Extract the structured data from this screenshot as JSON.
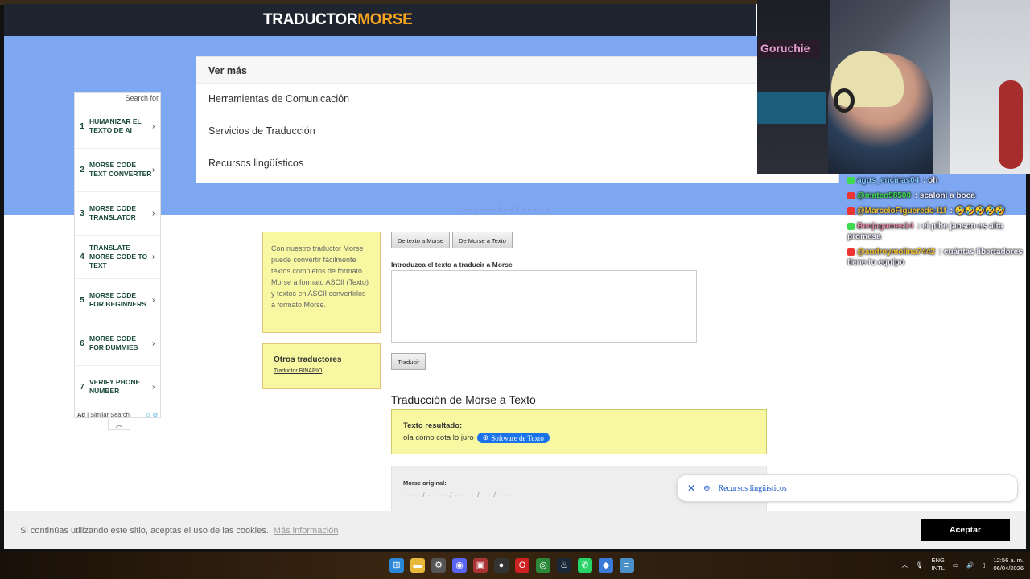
{
  "site": {
    "logo_part1": "TRADUCTOR",
    "logo_part2": "MORSE"
  },
  "ver_mas": {
    "heading": "Ver más",
    "items": [
      "Herramientas de Comunicación",
      "Servicios de Traducción",
      "Recursos lingüísticos"
    ]
  },
  "ad": {
    "search_label": "Search for",
    "items": [
      {
        "num": "1",
        "label": "HUMANIZAR EL TEXTO DE AI"
      },
      {
        "num": "2",
        "label": "MORSE CODE TEXT CONVERTER"
      },
      {
        "num": "3",
        "label": "MORSE CODE TRANSLATOR"
      },
      {
        "num": "4",
        "label": "TRANSLATE MORSE CODE TO TEXT"
      },
      {
        "num": "5",
        "label": "MORSE CODE FOR BEGINNERS"
      },
      {
        "num": "6",
        "label": "MORSE CODE FOR DUMMIES"
      },
      {
        "num": "7",
        "label": "VERIFY PHONE NUMBER"
      }
    ],
    "footer_ad": "Ad",
    "footer_label": "Similar Search"
  },
  "info": {
    "text": "Con nuestro traductor Morse puede convertir fácilmente textos completos de formato Morse a formato ASCII (Texto) y textos en ASCII convertirlos a formato Morse."
  },
  "otros": {
    "title": "Otros traductores",
    "link": "Traductor BINARIO"
  },
  "tabs": {
    "to_morse": "De texto a Morse",
    "from_morse": "De Morse a Texto"
  },
  "input_label": "Introduzca el texto a traducir a Morse",
  "translate_button": "Traducir",
  "result_section": {
    "heading": "Traducción de Morse a Texto",
    "result_label": "Texto resultado:",
    "result_value": "ola como cota lo juro",
    "pill_label": "Software de Texto"
  },
  "original": {
    "label": "Morse original:",
    "value": "- - -- / - - - - / - - - - / - - / - - - -"
  },
  "toast": {
    "label": "Recursos lingüísticos"
  },
  "cookie": {
    "text": "Si continúas utilizando este sitio, aceptas el uso de las cookies.",
    "more": "Más información",
    "accept": "Aceptar"
  },
  "stream": {
    "overlay_label": "Goruchie",
    "chat": [
      {
        "user": "agus_encinas04",
        "msg": "oh",
        "color": "#7ec6ff"
      },
      {
        "user": "@mateo98500",
        "msg": "scaloni a boca",
        "color": "#3fdc52"
      },
      {
        "user": "@MarceloFigueredo-l1f",
        "msg": "🤣🤣🤣🤣🤣",
        "color": "#f2c12e"
      },
      {
        "user": "Benjagames14",
        "msg": "el pibe janson es alta promesa",
        "color": "#e58ba6"
      },
      {
        "user": "@audreymolina7442",
        "msg": "cuántas libertadores tiene tu equipo",
        "color": "#f2c12e"
      }
    ]
  },
  "taskbar": {
    "lang1": "ENG",
    "lang2": "INTL",
    "time": "12:56 a. m.",
    "date": "06/04/2026"
  }
}
